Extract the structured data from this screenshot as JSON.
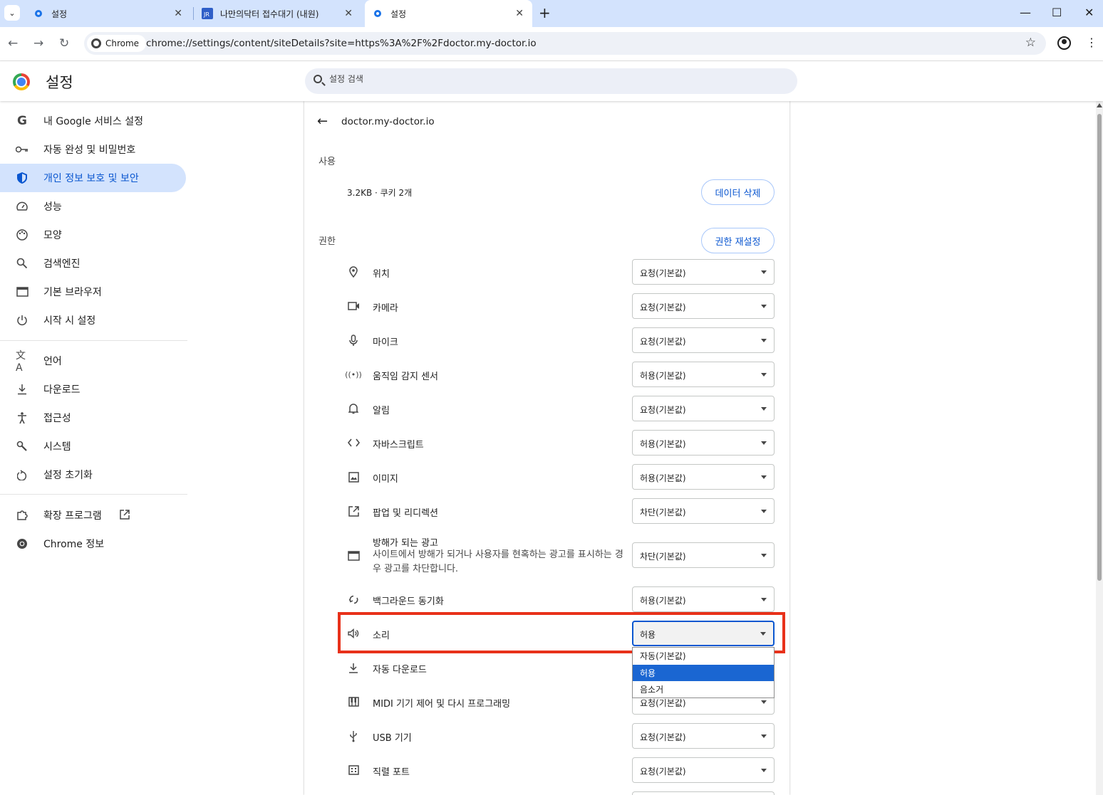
{
  "browser": {
    "tabs": [
      {
        "title": "설정",
        "active": false
      },
      {
        "title": "나만의닥터 접수대기 (내원)",
        "active": false
      },
      {
        "title": "설정",
        "active": true
      }
    ],
    "new_tab_icon": "plus-icon",
    "url": "chrome://settings/content/siteDetails?site=https%3A%2F%2Fdoctor.my-doctor.io",
    "security_chip": "Chrome",
    "window_controls": [
      "minimize-icon",
      "maximize-icon",
      "close-icon"
    ]
  },
  "header": {
    "title": "설정",
    "search_placeholder": "설정 검색"
  },
  "sidebar": {
    "items": [
      {
        "label": "내 Google 서비스 설정",
        "icon": "google-icon",
        "selected": false
      },
      {
        "label": "자동 완성 및 비밀번호",
        "icon": "key-icon",
        "selected": false
      },
      {
        "label": "개인 정보 보호 및 보안",
        "icon": "shield-icon",
        "selected": true
      },
      {
        "label": "성능",
        "icon": "speedometer-icon",
        "selected": false
      },
      {
        "label": "모양",
        "icon": "palette-icon",
        "selected": false
      },
      {
        "label": "검색엔진",
        "icon": "search-icon",
        "selected": false
      },
      {
        "label": "기본 브라우저",
        "icon": "browser-window-icon",
        "selected": false
      },
      {
        "label": "시작 시 설정",
        "icon": "power-icon",
        "selected": false
      },
      {
        "label": "언어",
        "icon": "translate-icon",
        "selected": false
      },
      {
        "label": "다운로드",
        "icon": "download-icon",
        "selected": false
      },
      {
        "label": "접근성",
        "icon": "accessibility-icon",
        "selected": false
      },
      {
        "label": "시스템",
        "icon": "wrench-icon",
        "selected": false
      },
      {
        "label": "설정 초기화",
        "icon": "reset-icon",
        "selected": false
      },
      {
        "label": "확장 프로그램",
        "icon": "puzzle-icon",
        "selected": false
      },
      {
        "label": "Chrome 정보",
        "icon": "chrome-icon",
        "selected": false
      }
    ]
  },
  "site": {
    "name": "doctor.my-doctor.io",
    "usage_heading": "사용",
    "usage_text": "3.2KB · 쿠키 2개",
    "delete_data_button": "데이터 삭제",
    "permissions_heading": "권한",
    "reset_permissions_button": "권한 재설정"
  },
  "permissions": [
    {
      "label": "위치",
      "icon": "location-pin-icon",
      "value": "요청(기본값)"
    },
    {
      "label": "카메라",
      "icon": "camera-icon",
      "value": "요청(기본값)"
    },
    {
      "label": "마이크",
      "icon": "microphone-icon",
      "value": "요청(기본값)"
    },
    {
      "label": "움직임 감지 센서",
      "icon": "sensors-icon",
      "value": "허용(기본값)"
    },
    {
      "label": "알림",
      "icon": "bell-icon",
      "value": "요청(기본값)"
    },
    {
      "label": "자바스크립트",
      "icon": "code-icon",
      "value": "허용(기본값)"
    },
    {
      "label": "이미지",
      "icon": "image-icon",
      "value": "허용(기본값)"
    },
    {
      "label": "팝업 및 리디렉션",
      "icon": "open-external-icon",
      "value": "차단(기본값)"
    },
    {
      "label": "방해가 되는 광고",
      "description": "사이트에서 방해가 되거나 사용자를 현혹하는 광고를 표시하는 경우 광고를 차단합니다.",
      "icon": "ad-window-icon",
      "value": "차단(기본값)"
    },
    {
      "label": "백그라운드 동기화",
      "icon": "sync-icon",
      "value": "허용(기본값)"
    },
    {
      "label": "소리",
      "icon": "speaker-icon",
      "value": "허용"
    },
    {
      "label": "자동 다운로드",
      "icon": "download-icon",
      "value": ""
    },
    {
      "label": "MIDI 기기 제어 및 다시 프로그래밍",
      "icon": "piano-icon",
      "value": "요청(기본값)"
    },
    {
      "label": "USB 기기",
      "icon": "usb-icon",
      "value": "요청(기본값)"
    },
    {
      "label": "직렬 포트",
      "icon": "serial-port-icon",
      "value": "요청(기본값)"
    }
  ],
  "sound_dropdown": {
    "options": [
      "자동(기본값)",
      "허용",
      "음소거"
    ],
    "selected": "허용"
  },
  "colors": {
    "accent": "#0b57d0",
    "selected_nav_bg": "#d3e3fd",
    "highlight_box": "#e8311a",
    "dropdown_selected": "#1a66d2"
  }
}
